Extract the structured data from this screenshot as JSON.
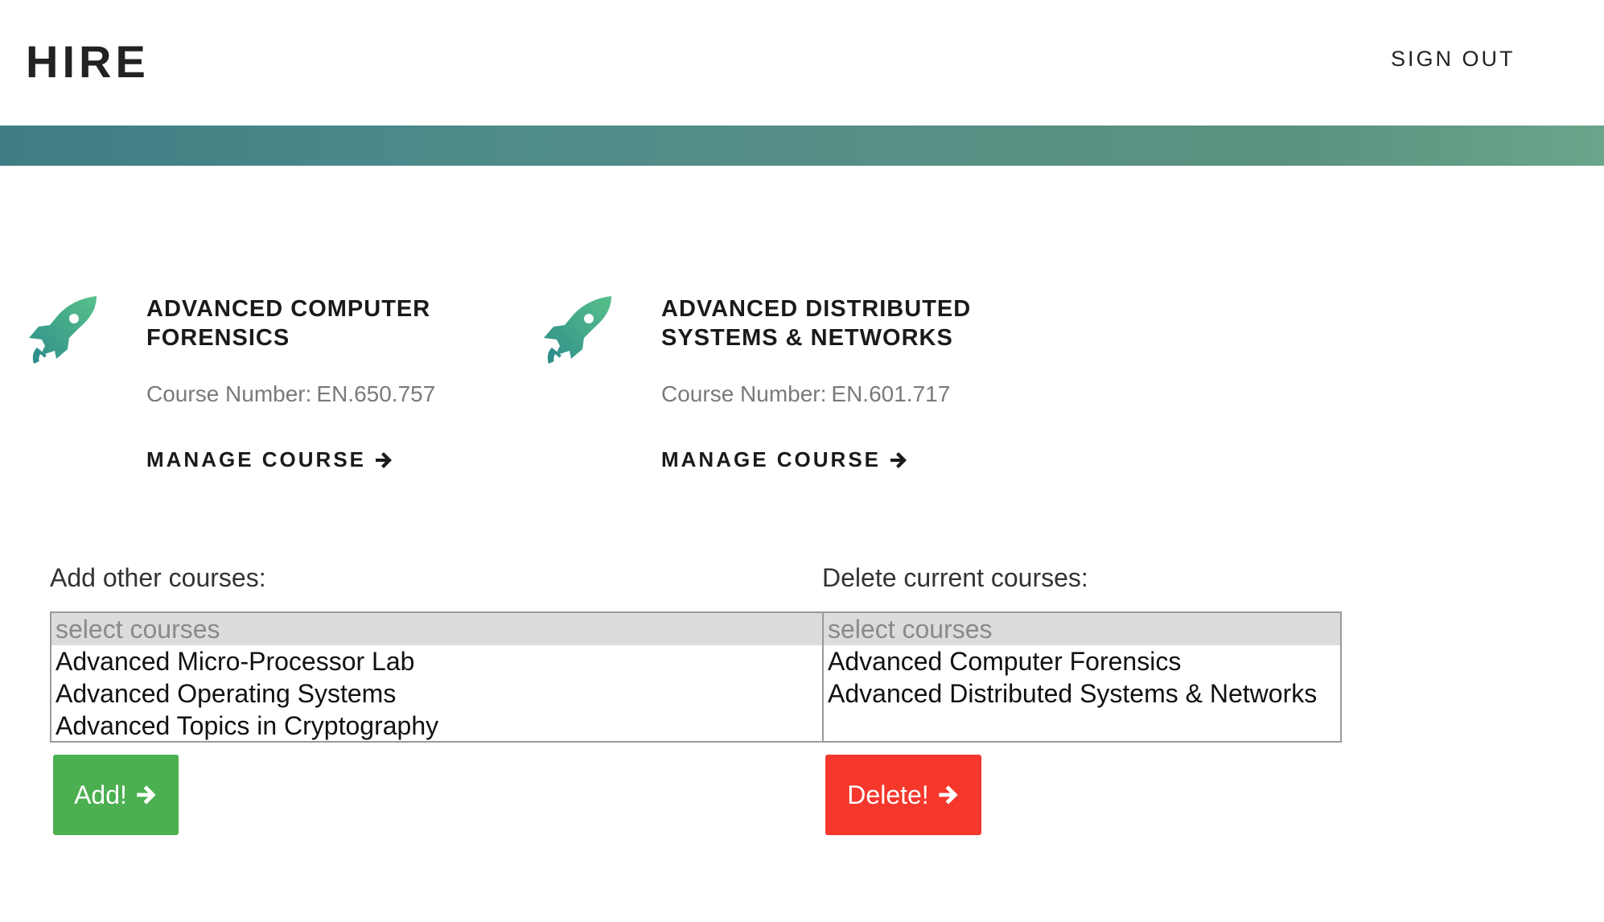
{
  "header": {
    "brand": "HIRE",
    "sign_out": "SIGN OUT"
  },
  "colors": {
    "accent_rocket": "#4fb58c",
    "add_button": "#4caf50",
    "delete_button": "#f5372c",
    "banner": "#4b8a8a"
  },
  "courses": [
    {
      "title": "ADVANCED COMPUTER FORENSICS",
      "number_label": "Course Number:",
      "number": "EN.650.757",
      "action": "MANAGE COURSE",
      "icon": "rocket-icon"
    },
    {
      "title": "ADVANCED DISTRIBUTED SYSTEMS & NETWORKS",
      "number_label": "Course Number:",
      "number": "EN.601.717",
      "action": "MANAGE COURSE",
      "icon": "rocket-icon"
    }
  ],
  "add_section": {
    "label": "Add other courses:",
    "placeholder": "select courses",
    "options": [
      "Advanced Micro-Processor Lab",
      "Advanced Operating Systems",
      "Advanced Topics in Cryptography"
    ],
    "button": "Add!"
  },
  "delete_section": {
    "label": "Delete current courses:",
    "placeholder": "select courses",
    "options": [
      "Advanced Computer Forensics",
      "Advanced Distributed Systems & Networks"
    ],
    "button": "Delete!"
  }
}
